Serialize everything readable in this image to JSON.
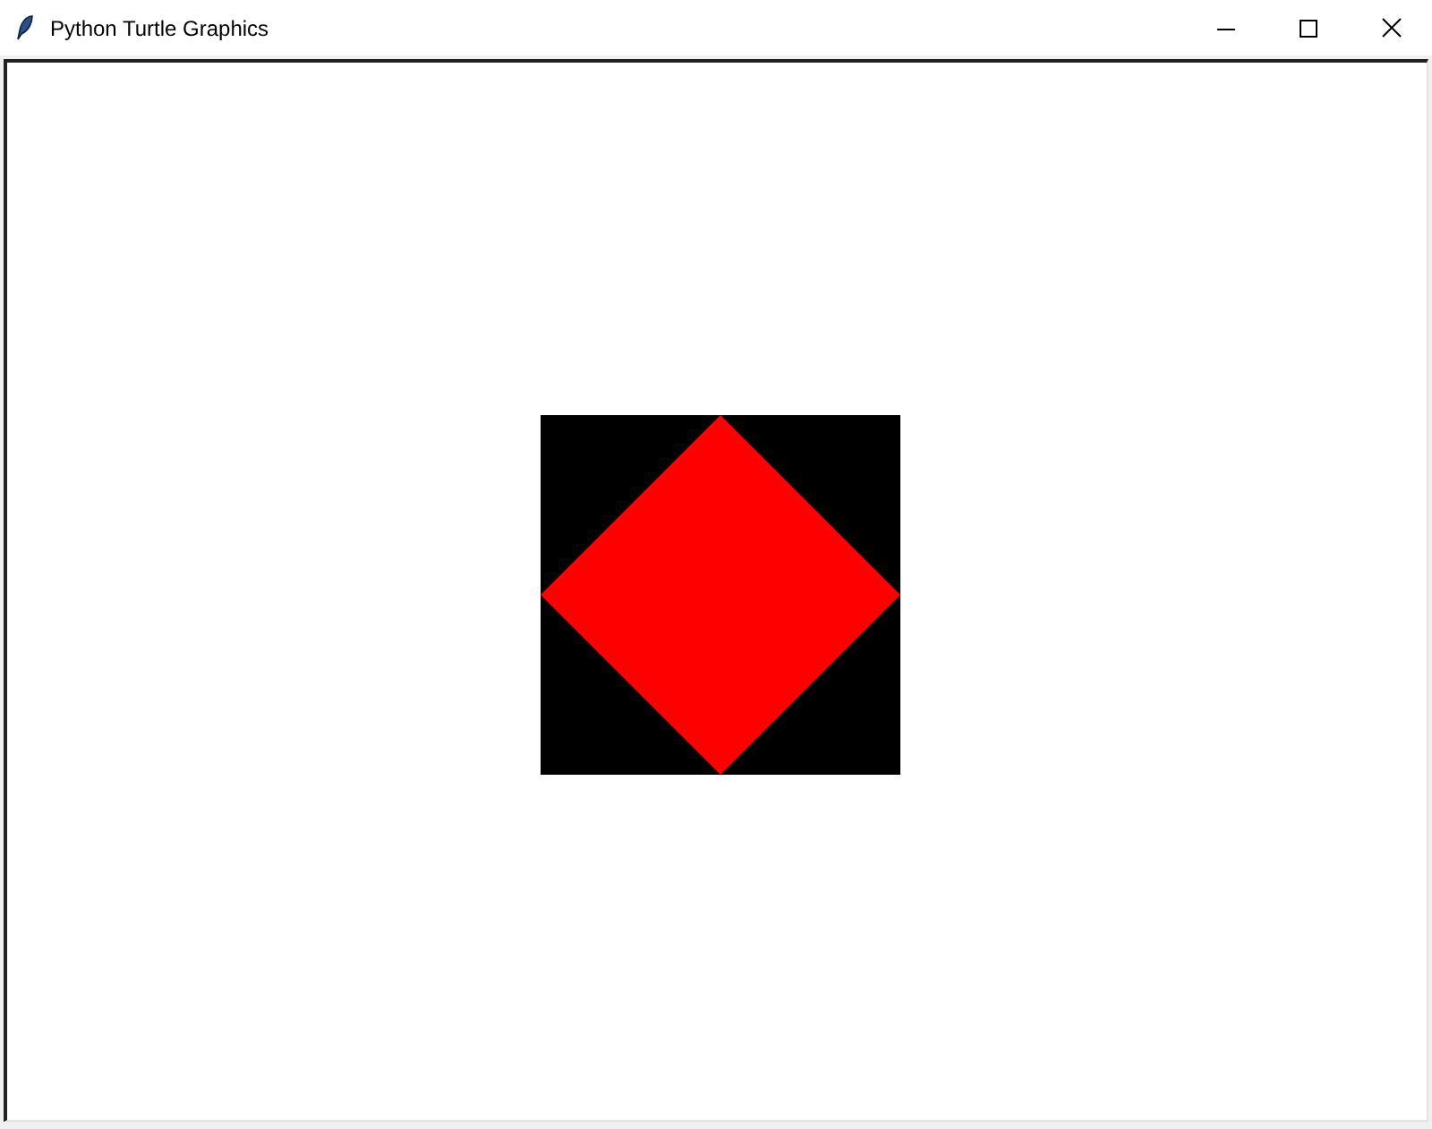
{
  "window": {
    "title": "Python Turtle Graphics"
  },
  "canvas": {
    "shapes": [
      {
        "kind": "square",
        "color": "#000000"
      },
      {
        "kind": "diamond",
        "color": "#ff0000"
      }
    ]
  }
}
